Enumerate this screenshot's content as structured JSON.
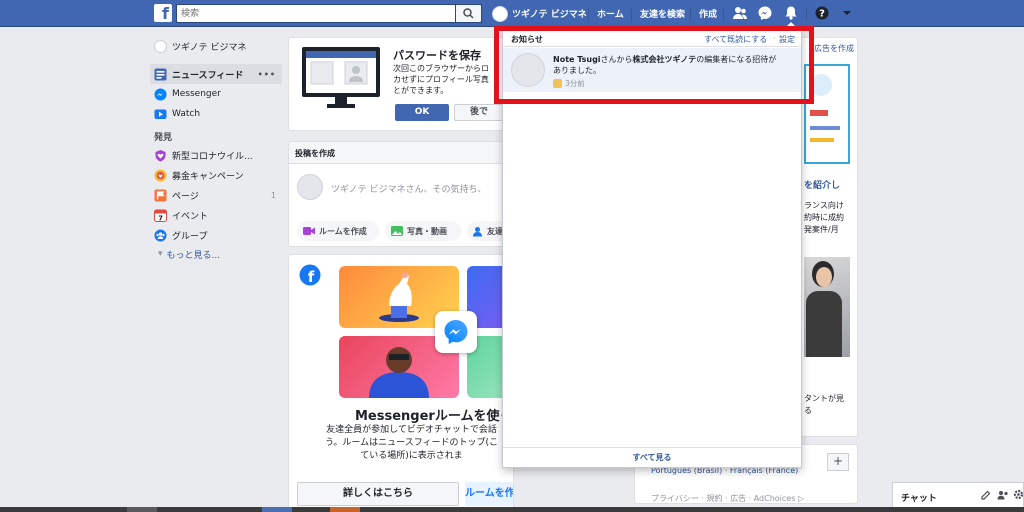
{
  "header": {
    "search_placeholder": "検索",
    "profile_name": "ツギノテ ビジマネ",
    "nav_home": "ホーム",
    "nav_find_friends": "友達を検索",
    "nav_create": "作成"
  },
  "sidebar": {
    "profile_name": "ツギノテ ビジマネ",
    "items": [
      {
        "label": "ニュースフィード",
        "color": "#4267b2"
      },
      {
        "label": "Messenger",
        "color": "#0084ff"
      },
      {
        "label": "Watch",
        "color": "#1877f2"
      }
    ],
    "explore_title": "発見",
    "explore": [
      {
        "label": "新型コロナウイル...",
        "color": "#a742d6"
      },
      {
        "label": "募金キャンペーン",
        "color": "#e0514a"
      },
      {
        "label": "ページ",
        "count": "1",
        "color": "#f4733b"
      },
      {
        "label": "イベント",
        "color": "#e4473d"
      },
      {
        "label": "グループ",
        "color": "#1877f2"
      }
    ],
    "more": "もっと見る..."
  },
  "password_card": {
    "title": "パスワードを保存",
    "body": "次回このブラウザーからロ\nカせずにプロフィール写真\nとができます。",
    "ok": "OK",
    "later": "後で"
  },
  "composer": {
    "header": "投稿を作成",
    "placeholder": "ツギノテ ビジマネさん、その気持ち、",
    "room": "ルームを作成",
    "photo": "写真・動画",
    "friends": "友達"
  },
  "promo": {
    "headline": "Messengerルームを使っ",
    "body": "友達全員が参加してビデオチャットで会話\nう。ルームはニュースフィードのトップ(こ\nている場所)に表示されま",
    "learn_more": "詳しくはこちら",
    "create_room": "ルームを作成"
  },
  "right": {
    "ad_create": "広告を作成",
    "sponsor_title": "を紹介し",
    "sponsor_lines": [
      "ランス向け",
      "約時に成約",
      "発案件/月"
    ],
    "sponsor2_lines": [
      "タントが見",
      "る"
    ],
    "languages": "Português (Brasil) · Français (France)",
    "footer": "プライバシー · 規約 · 広告 · AdChoices ▷"
  },
  "notifications": {
    "title": "お知らせ",
    "mark_all": "すべて既読にする",
    "settings": "設定",
    "item_actor": "Note Tsugi",
    "item_mid": "さんから",
    "item_org": "株式会社ツギノテ",
    "item_tail": "の編集者になる招待が",
    "item_tail2": "ありました。",
    "item_time": "3分前",
    "see_all": "すべて見る"
  },
  "chat": {
    "label": "チャット"
  },
  "colors": {
    "brand": "#4267b2",
    "highlight": "#e4101a"
  }
}
